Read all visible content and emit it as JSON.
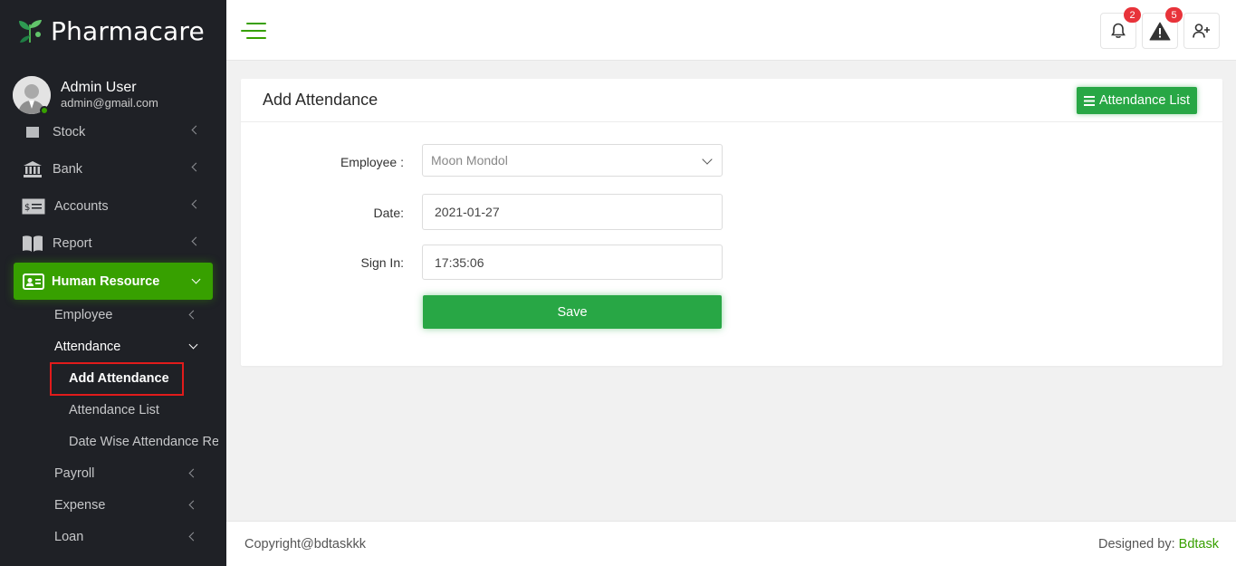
{
  "brand": {
    "name": "Pharmacare"
  },
  "user": {
    "name": "Admin User",
    "email": "admin@gmail.com"
  },
  "sidebar": {
    "items": [
      {
        "label": "Stock"
      },
      {
        "label": "Bank"
      },
      {
        "label": "Accounts"
      },
      {
        "label": "Report"
      }
    ],
    "active": {
      "label": "Human Resource"
    },
    "sub_items": [
      {
        "label": "Employee"
      },
      {
        "label": "Attendance"
      },
      {
        "label": "Payroll"
      },
      {
        "label": "Expense"
      },
      {
        "label": "Loan"
      }
    ],
    "attendance_children": [
      {
        "label": "Add Attendance"
      },
      {
        "label": "Attendance List"
      },
      {
        "label": "Date Wise Attendance Re"
      }
    ]
  },
  "header": {
    "notifications_count": "2",
    "alerts_count": "5"
  },
  "card": {
    "title": "Add Attendance",
    "list_button": "Attendance List",
    "form": {
      "employee_label": "Employee :",
      "employee_value": "Moon Mondol",
      "date_label": "Date:",
      "date_value": "2021-01-27",
      "signin_label": "Sign In:",
      "signin_value": "17:35:06",
      "save_label": "Save"
    }
  },
  "footer": {
    "copyright": "Copyright@bdtaskkk",
    "designed_by": "Designed by:",
    "designer": "Bdtask"
  },
  "colors": {
    "accent": "#37a000",
    "button": "#28a745",
    "sidebar": "#1f2126",
    "badge": "#e8333a",
    "highlight": "#e11b1b"
  }
}
